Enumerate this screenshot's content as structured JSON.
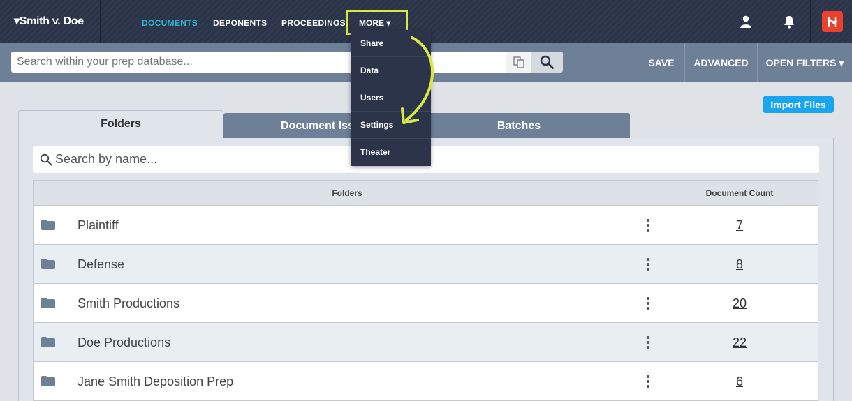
{
  "case": {
    "title": "▾Smith v. Doe"
  },
  "nav": {
    "documents": "DOCUMENTS",
    "deponents": "DEPONENTS",
    "proceedings": "PROCEEDINGS",
    "more": "MORE ▾"
  },
  "icons": {
    "user": "user-icon",
    "bell": "bell-icon",
    "brand": "brand-logo",
    "copy": "copy-icon",
    "search": "search-icon",
    "folder": "folder-icon"
  },
  "colors": {
    "nav_bg": "#2b3448",
    "accent": "#2bb6cf",
    "highlight": "#d7e843",
    "import_btn": "#1aa5f0",
    "brand": "#e8412c"
  },
  "search": {
    "placeholder": "Search within your prep database..."
  },
  "toolbar": {
    "save": "SAVE",
    "advanced": "ADVANCED",
    "open_filters": "OPEN FILTERS ▾"
  },
  "dropdown": {
    "items": [
      "Share",
      "Data",
      "Users",
      "Settings",
      "Theater"
    ]
  },
  "import_files": "Import Files",
  "tabs": {
    "folders": "Folders",
    "document_issues": "Document Issu",
    "batches": "Batches"
  },
  "name_search": {
    "placeholder": "Search by name..."
  },
  "table": {
    "headers": {
      "folders": "Folders",
      "count": "Document Count"
    },
    "rows": [
      {
        "name": "Plaintiff",
        "count": "7"
      },
      {
        "name": "Defense",
        "count": "8"
      },
      {
        "name": "Smith Productions",
        "count": "20"
      },
      {
        "name": "Doe Productions",
        "count": "22"
      },
      {
        "name": "Jane Smith Deposition Prep",
        "count": "6"
      }
    ]
  }
}
